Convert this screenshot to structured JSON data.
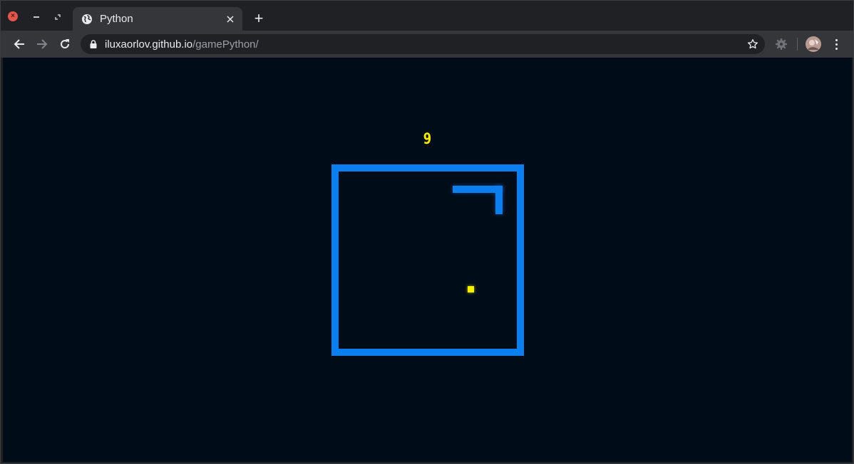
{
  "browser": {
    "tab": {
      "title": "Python",
      "favicon": "globe-icon"
    },
    "new_tab_label": "+",
    "address": {
      "host": "iluxaorlov.github.io",
      "path": "/gamePython/"
    },
    "icons": {
      "back": "arrow-left-icon",
      "forward": "arrow-right-icon",
      "reload": "reload-icon",
      "lock": "lock-icon",
      "bookmark": "star-icon",
      "extension": "gear-icon",
      "menu": "kebab-menu-icon"
    }
  },
  "game": {
    "score": "9",
    "colors": {
      "background": "#000c18",
      "wall": "#0a7ff0",
      "snake": "#0a7ff0",
      "food": "#f5f000",
      "score": "#f5e600"
    }
  }
}
